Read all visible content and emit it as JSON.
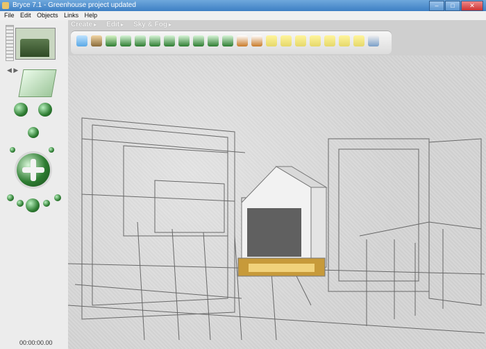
{
  "window": {
    "title": "Bryce 7.1 - Greenhouse project updated",
    "buttons": {
      "minimize": "–",
      "maximize": "□",
      "close": "✕"
    }
  },
  "menu": [
    "File",
    "Edit",
    "Objects",
    "Links",
    "Help"
  ],
  "palettes": {
    "tabs": [
      "Create",
      "Edit",
      "Sky & Fog"
    ],
    "arrow": "▸",
    "items": [
      "water-plane",
      "terrain",
      "tree",
      "rock",
      "sphere",
      "torus",
      "cube",
      "cone",
      "pyramid",
      "cylinder",
      "disk",
      "light",
      "sphere-light",
      "materials",
      "materials",
      "materials",
      "materials",
      "materials",
      "materials",
      "materials",
      "camera"
    ]
  },
  "timeline": {
    "time": "00:00:00.00"
  },
  "colors": {
    "titlebar": "#3d7fc4",
    "palette_yellow": "#e6d86a",
    "palette_green": "#2e7d32",
    "canvas_bg": "#d3d3d3"
  }
}
